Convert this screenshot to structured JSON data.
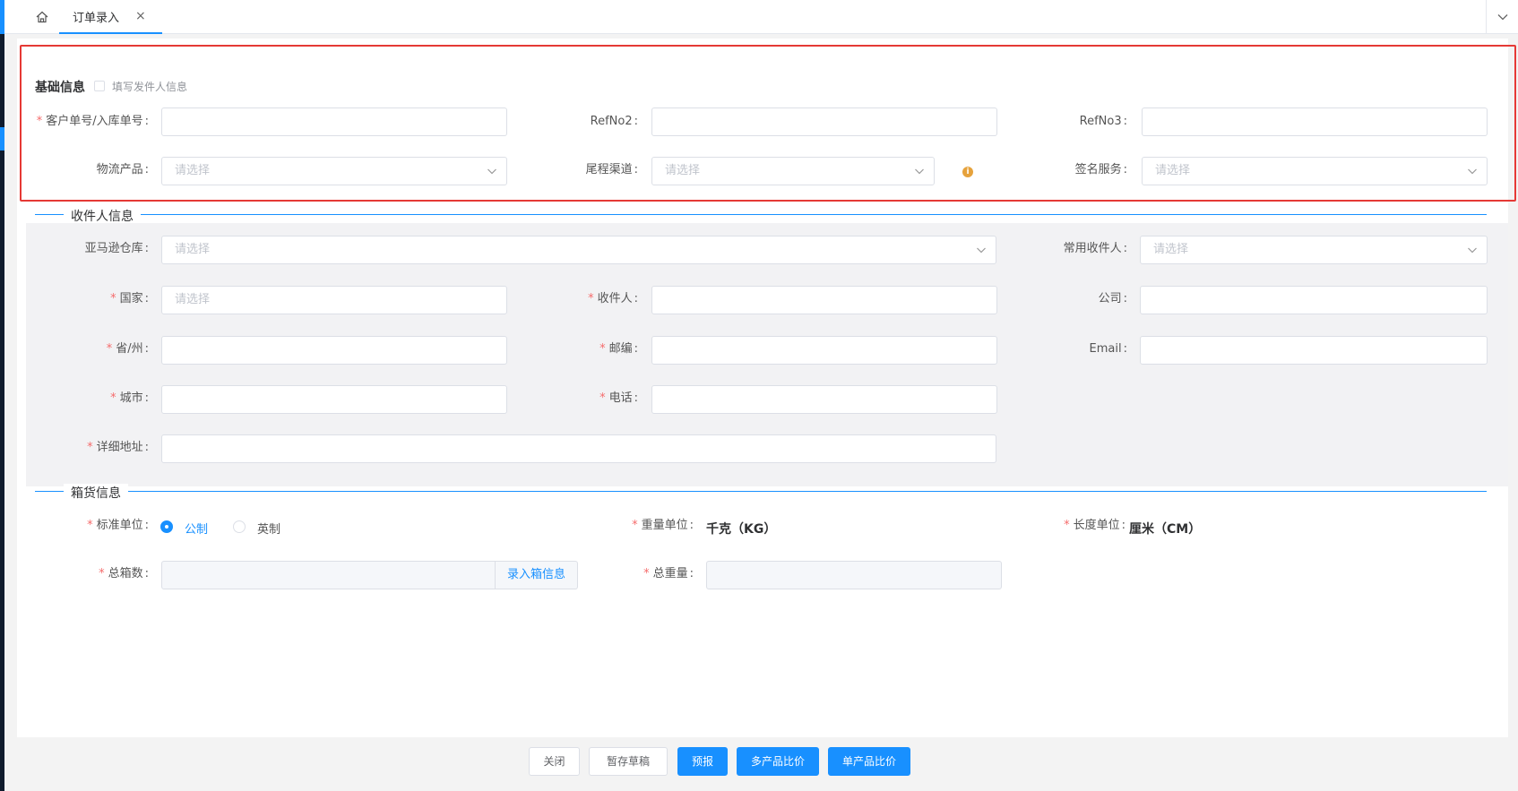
{
  "tabs": {
    "active_label": "订单录入",
    "close_glyph": "×"
  },
  "basic": {
    "title": "基础信息",
    "fill_sender_label": "填写发件人信息",
    "customer_no_label": "客户单号/入库单号",
    "refno2_label": "RefNo2",
    "refno3_label": "RefNo3",
    "product_label": "物流产品",
    "last_mile_label": "尾程渠道",
    "signature_label": "签名服务",
    "select_placeholder": "请选择"
  },
  "recipient": {
    "title": "收件人信息",
    "amazon_wh_label": "亚马逊仓库",
    "common_recipient_label": "常用收件人",
    "country_label": "国家",
    "recipient_label": "收件人",
    "company_label": "公司",
    "state_label": "省/州",
    "postcode_label": "邮编",
    "email_label": "Email",
    "city_label": "城市",
    "phone_label": "电话",
    "address_label": "详细地址",
    "select_placeholder": "请选择"
  },
  "cargo": {
    "title": "箱货信息",
    "std_unit_label": "标准单位",
    "metric_label": "公制",
    "imperial_label": "英制",
    "weight_unit_label": "重量单位",
    "weight_unit_value": "千克（KG）",
    "length_unit_label": "长度单位",
    "length_unit_value": "厘米（CM）",
    "total_boxes_label": "总箱数",
    "enter_box_info": "录入箱信息",
    "total_weight_label": "总重量"
  },
  "footer": {
    "close": "关闭",
    "save_draft": "暂存草稿",
    "forecast": "预报",
    "multi_compare": "多产品比价",
    "single_compare": "单产品比价"
  },
  "colors": {
    "accent": "#1890ff",
    "required": "#f56c6c",
    "highlight_box": "#e53935"
  }
}
